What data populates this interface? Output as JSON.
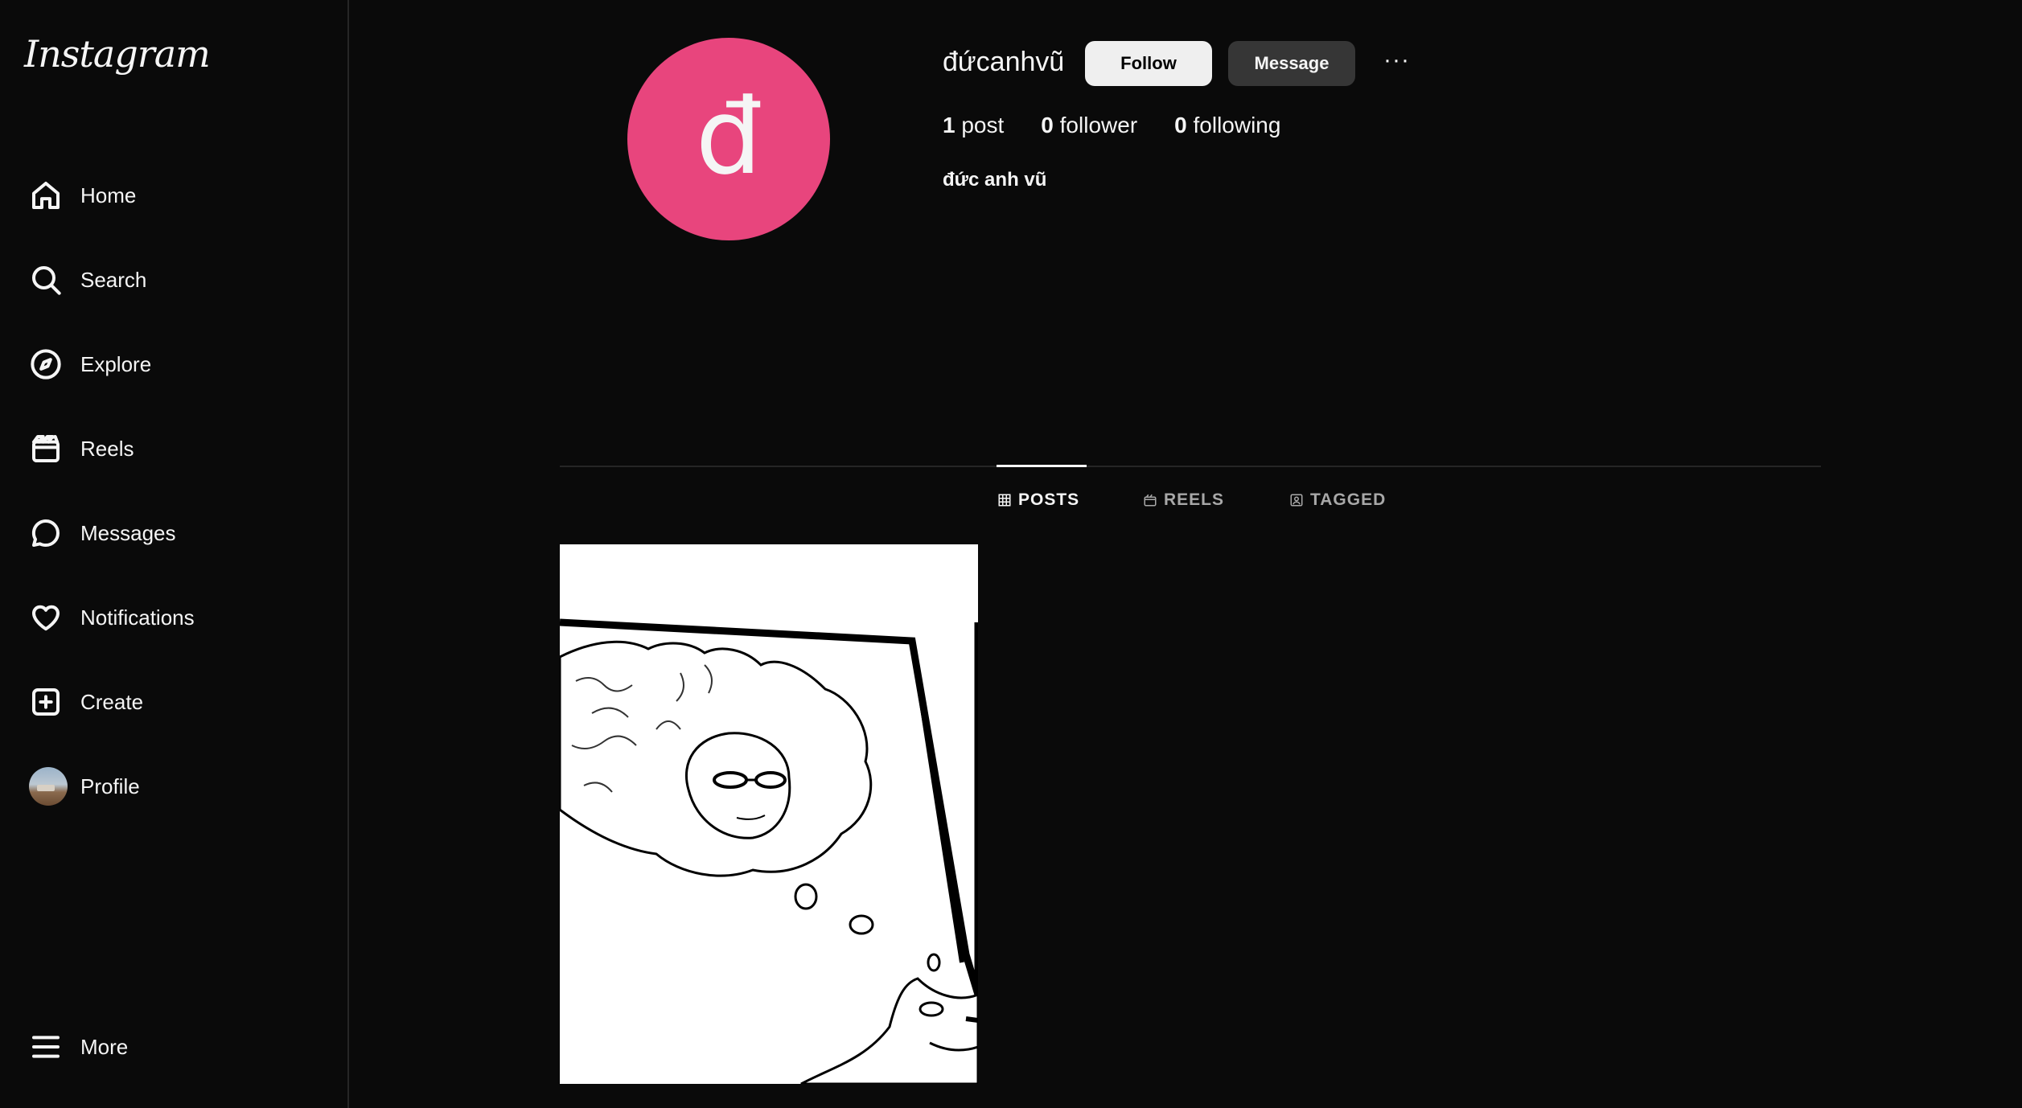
{
  "app": {
    "logo_text": "Instagram"
  },
  "sidebar": {
    "items": [
      {
        "label": "Home",
        "icon": "home-icon"
      },
      {
        "label": "Search",
        "icon": "search-icon"
      },
      {
        "label": "Explore",
        "icon": "compass-icon"
      },
      {
        "label": "Reels",
        "icon": "reels-icon"
      },
      {
        "label": "Messages",
        "icon": "message-bubble-icon"
      },
      {
        "label": "Notifications",
        "icon": "heart-icon"
      },
      {
        "label": "Create",
        "icon": "plus-square-icon"
      },
      {
        "label": "Profile",
        "icon": "profile-avatar"
      }
    ],
    "more_label": "More"
  },
  "profile": {
    "avatar_letter": "đ",
    "avatar_color": "#e8457d",
    "username": "đứcanhvũ",
    "follow_label": "Follow",
    "message_label": "Message",
    "options_label": "···",
    "posts_count": "1",
    "posts_label": "post",
    "followers_count": "0",
    "followers_label": "follower",
    "following_count": "0",
    "following_label": "following",
    "full_name": "đức anh vũ"
  },
  "tabs": [
    {
      "label": "POSTS",
      "active": true
    },
    {
      "label": "REELS",
      "active": false
    },
    {
      "label": "TAGGED",
      "active": false
    }
  ],
  "posts": [
    {
      "description": "meme drawing"
    }
  ]
}
